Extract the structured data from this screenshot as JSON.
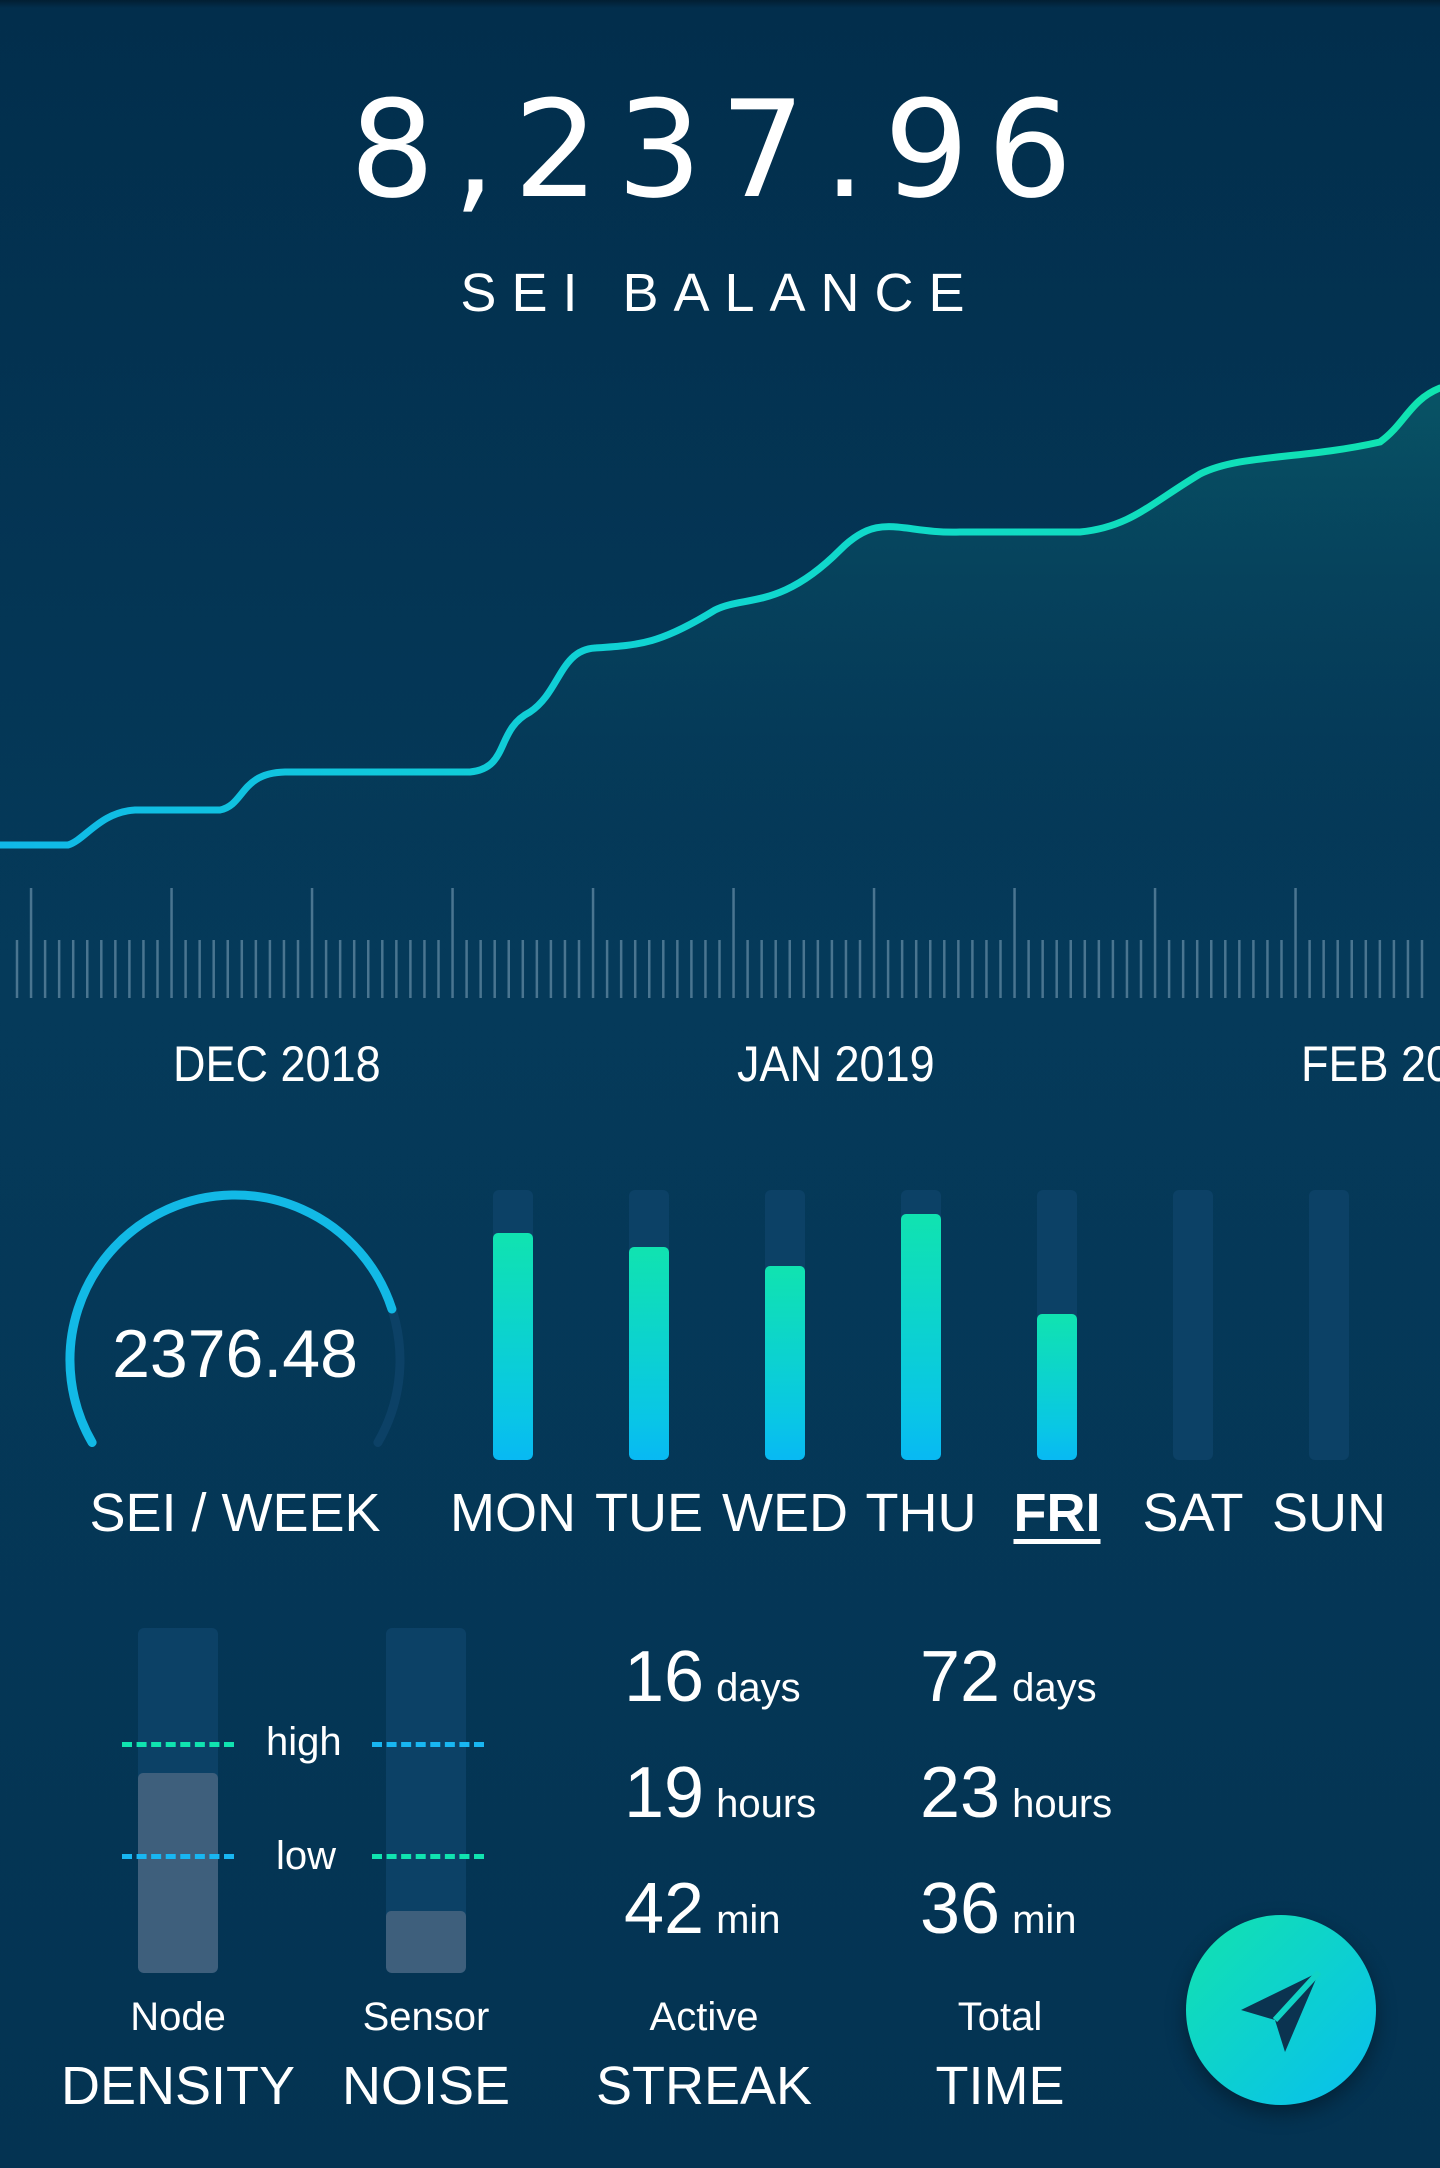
{
  "header": {
    "balance_value": "8,237.96",
    "balance_label": "SEI BALANCE"
  },
  "chart_data": {
    "type": "area",
    "x_labels": [
      "DEC 2018",
      "JAN 2019",
      "FEB 20"
    ],
    "colors": {
      "line_start": "#10b8e8",
      "line_end": "#10e3b0"
    }
  },
  "weekly": {
    "value": "2376.48",
    "label": "SEI / WEEK",
    "progress": 0.8
  },
  "days": [
    {
      "label": "MON",
      "level": 0.84
    },
    {
      "label": "TUE",
      "level": 0.79
    },
    {
      "label": "WED",
      "level": 0.72
    },
    {
      "label": "THU",
      "level": 0.91
    },
    {
      "label": "FRI",
      "level": 0.54,
      "active": true
    },
    {
      "label": "SAT",
      "level": 0
    },
    {
      "label": "SUN",
      "level": 0
    }
  ],
  "meters": {
    "high_label": "high",
    "low_label": "low",
    "density": {
      "small": "Node",
      "big": "DENSITY",
      "level": 0.58
    },
    "noise": {
      "small": "Sensor",
      "big": "NOISE",
      "level": 0.18
    }
  },
  "streak": {
    "days_num": "16",
    "days_unit": "days",
    "hours_num": "19",
    "hours_unit": "hours",
    "min_num": "42",
    "min_unit": "min",
    "small": "Active",
    "big": "STREAK"
  },
  "total": {
    "days_num": "72",
    "days_unit": "days",
    "hours_num": "23",
    "hours_unit": "hours",
    "min_num": "36",
    "min_unit": "min",
    "small": "Total",
    "big": "TIME"
  },
  "fab": {
    "icon": "send-icon"
  }
}
